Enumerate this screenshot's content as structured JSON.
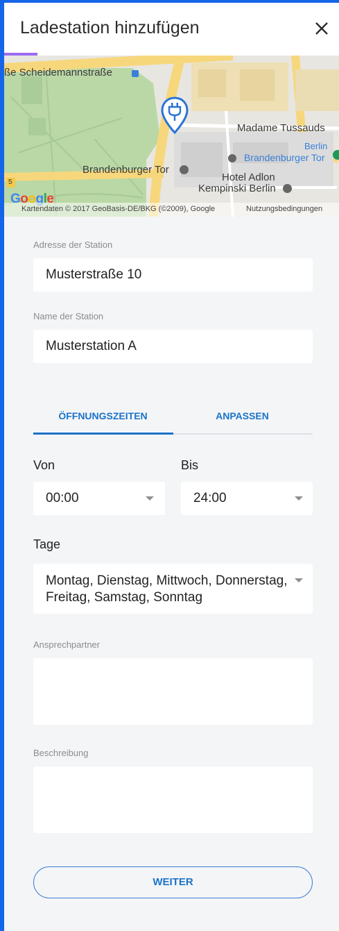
{
  "header": {
    "title": "Ladestation hinzufügen",
    "close_icon": "close-icon",
    "progress": 0.1
  },
  "map": {
    "labels": {
      "street": "ße  Scheidemannstraße",
      "madame": "Madame Tussauds",
      "berlin": "Berlin",
      "brandenburger_tor_blue": "Brandenburger Tor",
      "brandenburger_tor": "Brandenburger Tor",
      "hotel_line1": "Hotel Adlon",
      "hotel_line2": "Kempinski Berlin",
      "road_number": "5"
    },
    "google_logo": "Google",
    "attribution": "Kartendaten © 2017 GeoBasis-DE/BKG (©2009), Google",
    "terms": "Nutzungsbedingungen",
    "marker_icon": "charging-plug-icon"
  },
  "form": {
    "address": {
      "label": "Adresse der Station",
      "value": "Musterstraße 10"
    },
    "name": {
      "label": "Name der Station",
      "value": "Musterstation A"
    }
  },
  "tabs": [
    {
      "label": "ÖFFNUNGSZEITEN",
      "active": true
    },
    {
      "label": "ANPASSEN",
      "active": false
    }
  ],
  "hours": {
    "from_label": "Von",
    "from_value": "00:00",
    "to_label": "Bis",
    "to_value": "24:00"
  },
  "days": {
    "label": "Tage",
    "value": "Montag, Dienstag, Mittwoch, Donnerstag, Freitag, Samstag, Sonntag"
  },
  "contact": {
    "label": "Ansprechpartner",
    "value": ""
  },
  "description": {
    "label": "Beschreibung",
    "value": ""
  },
  "actions": {
    "next_label": "WEITER"
  },
  "colors": {
    "outer_frame": "#1565e8",
    "accent": "#1a73c8",
    "progress": "#9b6cf0",
    "background": "#f4f5f7"
  }
}
